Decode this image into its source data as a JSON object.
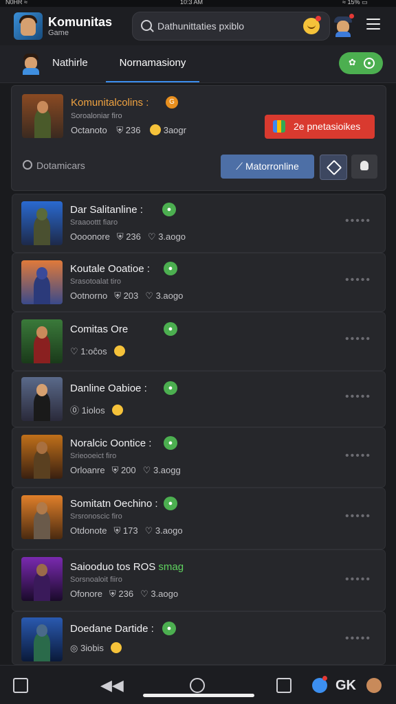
{
  "status": {
    "left": "N0HR ≈",
    "center": "10:3 AM",
    "right": "≈ 15% ▭"
  },
  "header": {
    "title": "Komunitas",
    "subtitle": "Game",
    "search_text": "Dathunittaties pxiblo"
  },
  "tabs": {
    "first": "Nathirle",
    "second": "Nornamasiony"
  },
  "featured": {
    "title": "Komunitalcolins :",
    "coin": "G",
    "subtitle": "Soroaloniar firo",
    "stat1": "Octanoto",
    "stat2": "236",
    "stat3": "3aogr",
    "cta": "2e pnetasioikes",
    "filter": "Dotamicars",
    "primary_button": "Matorronline"
  },
  "items": [
    {
      "name": "Dar Salitanline :",
      "sub": "Sraaoottt fiaro",
      "meta1": "Oooonore",
      "meta2": "236",
      "meta3": "3.aogo"
    },
    {
      "name": "Koutale Ooatioe :",
      "sub": "Srasotoalat tiro",
      "meta1": "Ootnorno",
      "meta2": "203",
      "meta3": "3.aogo"
    },
    {
      "name": "Comitas Ore",
      "sub": "",
      "meta1": "1:oĉos",
      "meta2": "",
      "meta3": ""
    },
    {
      "name": "Danline Oabioe :",
      "sub": "",
      "meta1": "1iolos",
      "meta2": "",
      "meta3": ""
    },
    {
      "name": "Noralcic Oontice :",
      "sub": "Srieooeict firo",
      "meta1": "Orloanre",
      "meta2": "200",
      "meta3": "3.aogg"
    },
    {
      "name": "Somitatn Oechino :",
      "sub": "Srsronoscic firo",
      "meta1": "Otdonote",
      "meta2": "173",
      "meta3": "3.aogo"
    },
    {
      "name": "Saiooduo tos ROS",
      "name_extra": "smag",
      "sub": "Sorsnoaloit fiiro",
      "meta1": "Ofonore",
      "meta2": "236",
      "meta3": "3.aogo"
    },
    {
      "name": "Doedane Dartide :",
      "sub": "",
      "meta1": "3iobis",
      "meta2": "",
      "meta3": ""
    }
  ],
  "more_label": "•••••",
  "bottom": {
    "label": "GK"
  },
  "colors": {
    "accent": "#3c8ff0",
    "green": "#4caf50",
    "red": "#d93a2f",
    "orange": "#f0a341"
  }
}
